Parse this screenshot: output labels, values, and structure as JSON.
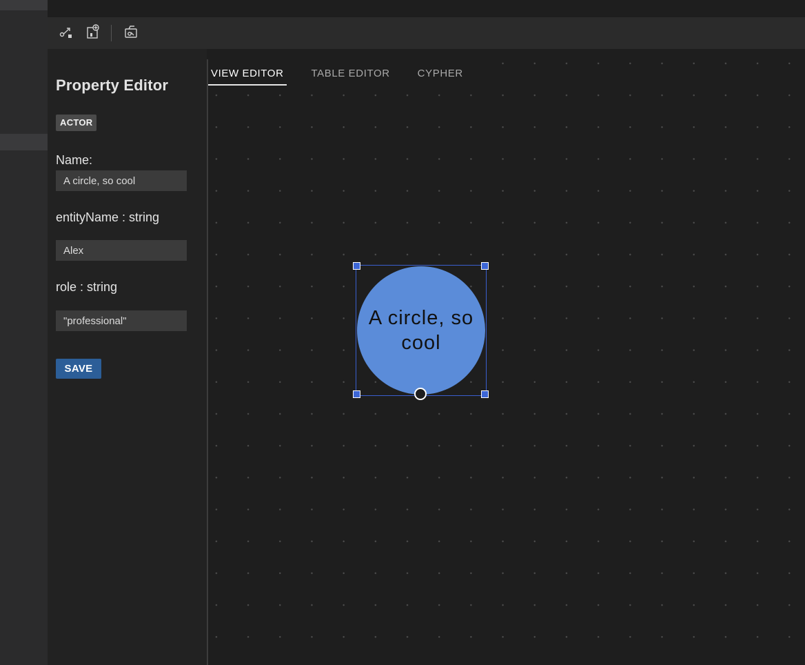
{
  "toolbar": {
    "buttons": [
      {
        "icon": "connect-nodes-icon"
      },
      {
        "icon": "add-node-icon"
      },
      {
        "icon": "layout-icon"
      }
    ]
  },
  "property_editor": {
    "title": "Property Editor",
    "entity_type": "ACTOR",
    "fields": [
      {
        "label": "Name:",
        "value": "A circle, so cool"
      },
      {
        "label": "entityName : string",
        "value": "Alex"
      },
      {
        "label": "role : string",
        "value": "\"professional\""
      }
    ],
    "save_label": "SAVE"
  },
  "tabs": [
    {
      "label": "VIEW EDITOR",
      "active": true
    },
    {
      "label": "TABLE EDITOR",
      "active": false
    },
    {
      "label": "CYPHER",
      "active": false
    }
  ],
  "canvas": {
    "node": {
      "label": "A circle, so cool",
      "fill": "#5b8cd9",
      "selected": true
    }
  },
  "colors": {
    "accent": "#2c5e98",
    "selection": "#3c66d6"
  }
}
